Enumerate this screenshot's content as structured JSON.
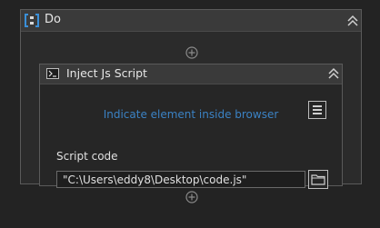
{
  "sequence": {
    "title": "Do",
    "icon": "sequence-brackets-icon",
    "collapse_icon": "double-chevron-up-icon",
    "add_icon": "add-activity-icon"
  },
  "activity": {
    "title": "Inject Js Script",
    "icon": "powershell-prompt-icon",
    "collapse_icon": "double-chevron-up-icon",
    "indicate_link": "Indicate element inside browser",
    "menu_icon": "hamburger-menu-icon",
    "script_code_label": "Script code",
    "script_code_value": "\"C:\\Users\\eddy8\\Desktop\\code.js\"",
    "browse_icon": "folder-icon"
  },
  "colors": {
    "background": "#232323",
    "link": "#3b82c4",
    "accent_icon": "#3a8fd8"
  }
}
